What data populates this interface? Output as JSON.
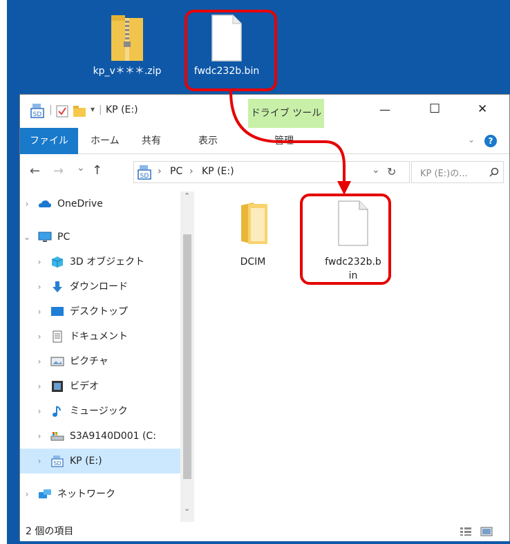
{
  "desktop": {
    "icons": [
      {
        "label": "kp_v＊＊＊.zip",
        "icon": "zip-folder-icon"
      },
      {
        "label": "fwdc232b.bin",
        "icon": "file-icon"
      }
    ]
  },
  "explorer": {
    "title": "KP (E:)",
    "context_tab": "ドライブ ツール",
    "window_controls": {
      "minimize": "—",
      "maximize": "☐",
      "close": "✕"
    },
    "ribbon": {
      "file": "ファイル",
      "home": "ホーム",
      "share": "共有",
      "view": "表示",
      "manage": "管理"
    },
    "nav": {
      "back": "←",
      "forward": "→",
      "recent": "⌄",
      "up": "↑",
      "path": [
        "PC",
        "KP (E:)"
      ],
      "separator": "›",
      "refresh": "↻",
      "search_placeholder": "KP (E:)の..."
    },
    "tree": [
      {
        "label": "OneDrive",
        "icon": "onedrive-icon"
      },
      {
        "label": "PC",
        "icon": "pc-icon"
      },
      {
        "label": "3D オブジェクト",
        "icon": "3d-objects-icon"
      },
      {
        "label": "ダウンロード",
        "icon": "download-icon"
      },
      {
        "label": "デスクトップ",
        "icon": "desktop-icon"
      },
      {
        "label": "ドキュメント",
        "icon": "document-icon"
      },
      {
        "label": "ピクチャ",
        "icon": "pictures-icon"
      },
      {
        "label": "ビデオ",
        "icon": "video-icon"
      },
      {
        "label": "ミュージック",
        "icon": "music-icon"
      },
      {
        "label": "S3A9140D001 (C:",
        "icon": "drive-icon"
      },
      {
        "label": "KP (E:)",
        "icon": "sd-card-icon",
        "selected": true
      },
      {
        "label": "ネットワーク",
        "icon": "network-icon"
      }
    ],
    "files": [
      {
        "label": "DCIM",
        "icon": "folder-icon"
      },
      {
        "label_line1": "fwdc232b.b",
        "label_line2": "in",
        "icon": "file-icon"
      }
    ],
    "status": "2 個の項目"
  },
  "colors": {
    "desktop": "#0f58a8",
    "highlight": "#e60000",
    "selection": "#cce8ff",
    "file_tab": "#1979ca",
    "context_tab": "#c8f0a8"
  }
}
